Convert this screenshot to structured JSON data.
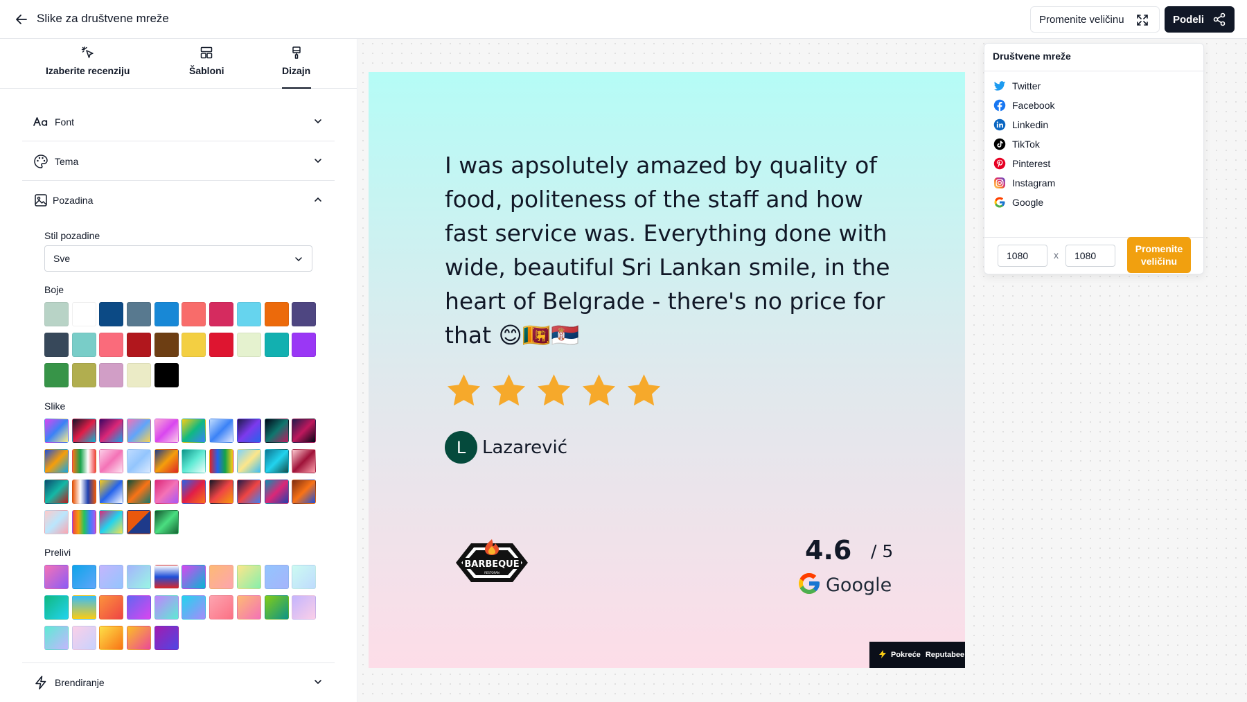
{
  "header": {
    "title": "Slike za društvene mreže",
    "resize_label": "Promenite veličinu",
    "share_label": "Podeli"
  },
  "tabs": [
    {
      "label": "Izaberite recenziju",
      "icon": "cursor-click-icon",
      "active": false
    },
    {
      "label": "Šabloni",
      "icon": "layout-template-icon",
      "active": false
    },
    {
      "label": "Dizajn",
      "icon": "paintbrush-icon",
      "active": true
    }
  ],
  "sections": {
    "font": "Font",
    "tema": "Tema",
    "pozadina": "Pozadina",
    "brendiranje": "Brendiranje"
  },
  "background": {
    "style_label": "Stil pozadine",
    "style_value": "Sve",
    "colors_label": "Boje",
    "images_label": "Slike",
    "gradients_label": "Prelivi",
    "colors": [
      "#b8d3c6",
      "#ffffff",
      "#0c4a85",
      "#58798f",
      "#1888d6",
      "#f86c6a",
      "#d52b5f",
      "#66d4ee",
      "#ec6a0b",
      "#4e4681",
      "#37485a",
      "#79cdc8",
      "#fa6b7b",
      "#b1171d",
      "#6d3e13",
      "#f3cf42",
      "#de1530",
      "#e5f2cf",
      "#12b0b0",
      "#9a37f5",
      "#379448",
      "#b1ae4f",
      "#d19ec6",
      "#ebebc6",
      "#000000"
    ],
    "images": [
      "linear-gradient(135deg,#d946ef,#3b82f6,#fef08a)",
      "linear-gradient(135deg,#0f172a,#e11d48,#06b6d4)",
      "linear-gradient(135deg,#3b0764,#db2777,#0ea5e9)",
      "linear-gradient(135deg,#f472b6,#60a5fa,#fcd34d)",
      "linear-gradient(135deg,#f9a8d4,#d946ef,#fbcfe8)",
      "linear-gradient(135deg,#facc15,#10b981,#3b82f6)",
      "linear-gradient(135deg,#bfdbfe,#3b82f6,#e0e7ff)",
      "linear-gradient(135deg,#1e1b4b,#7c3aed,#2563eb)",
      "linear-gradient(135deg,#020617,#0f766e,#be185d)",
      "linear-gradient(135deg,#1e1b4b,#be185d,#020617)",
      "linear-gradient(135deg,#1d4ed8,#f59e0b,#0ea5e9)",
      "linear-gradient(90deg,#f97316,#16a34a,#ffffff,#ef4444)",
      "linear-gradient(135deg,#fbcfe8,#f472b6,#fce7f3)",
      "linear-gradient(135deg,#bfdbfe,#93c5fd,#dbeafe)",
      "linear-gradient(135deg,#1e3a8a,#f59e0b,#dc2626)",
      "linear-gradient(135deg,#0d9488,#5eead4,#f0fdfa)",
      "linear-gradient(90deg,#dc2626,#2563eb,#16a34a,#facc15)",
      "linear-gradient(135deg,#7dd3fc,#fde68a,#38bdf8)",
      "linear-gradient(135deg,#0e7490,#22d3ee,#134e4a)",
      "linear-gradient(135deg,#fecdd3,#9f1239,#fda4af)",
      "linear-gradient(135deg,#0c4a6e,#14b8a6,#b91c1c)",
      "linear-gradient(90deg,#ea580c,#ffffff,#1e40af,#ea580c)",
      "linear-gradient(135deg,#facc15,#2563eb,#ffffff)",
      "linear-gradient(135deg,#064e3b,#f97316,#0f766e)",
      "linear-gradient(135deg,#db2777,#f472b6,#a855f7)",
      "linear-gradient(135deg,#2563eb,#e11d48,#f97316)",
      "linear-gradient(135deg,#111827,#ef4444,#f59e0b)",
      "linear-gradient(135deg,#1e1b4b,#ef4444,#3b82f6)",
      "linear-gradient(135deg,#0891b2,#db2777,#1e40af)",
      "linear-gradient(135deg,#7c2d12,#f97316,#1d4ed8)",
      "linear-gradient(135deg,#fecaca,#bae6fd,#fda4af)",
      "linear-gradient(90deg,#ef4444,#f59e0b,#22c55e,#3b82f6,#a855f7)",
      "linear-gradient(135deg,#db2777,#22d3ee,#fde047)",
      "linear-gradient(135deg,#ea580c 50%,#1e3a8a 50%)",
      "linear-gradient(135deg,#14532d,#4ade80,#166534)"
    ],
    "gradients": [
      "linear-gradient(135deg,#f472b6,#8b5cf6)",
      "linear-gradient(135deg,#0ea5e9,#60a5fa)",
      "linear-gradient(135deg,#c4b5fd,#93c5fd)",
      "linear-gradient(135deg,#a5b4fc,#99f6e4)",
      "linear-gradient(180deg,#ffffff,#1d4ed8,#dc2626)",
      "linear-gradient(135deg,#d946ef,#06b6d4)",
      "linear-gradient(135deg,#fdba74,#fda4af)",
      "linear-gradient(135deg,#fde68a,#86efac)",
      "linear-gradient(135deg,#93c5fd,#a5b4fc)",
      "linear-gradient(135deg,#ccfbf1,#bfdbfe)",
      "linear-gradient(135deg,#10b981,#22d3ee)",
      "linear-gradient(180deg,#38bdf8,#facc15)",
      "linear-gradient(135deg,#fb923c,#ef4444)",
      "linear-gradient(135deg,#6366f1,#d946ef)",
      "linear-gradient(135deg,#c084fc,#5eead4)",
      "linear-gradient(135deg,#22d3ee,#a78bfa)",
      "linear-gradient(135deg,#fda4af,#fb7185)",
      "linear-gradient(135deg,#fdba74,#f472b6)",
      "linear-gradient(135deg,#84cc16,#0d9488)",
      "linear-gradient(135deg,#c4b5fd,#fbcfe8)",
      "linear-gradient(135deg,#5eead4,#c4b5fd)",
      "linear-gradient(135deg,#fbcfe8,#c7d2fe)",
      "linear-gradient(135deg,#fde047,#f97316)",
      "linear-gradient(135deg,#fbbf24,#ec4899)",
      "linear-gradient(135deg,#a21caf,#4f46e5)"
    ]
  },
  "review": {
    "text": "I was apsolutely amazed by quality of food, politeness of the staff and how fast service was. Everything done with wide, beautiful Sri Lankan smile, in the heart of Belgrade - there's no price for that 😊🇱🇰🇷🇸",
    "stars": 5,
    "avatar_letter": "L",
    "author": "Lazarević",
    "logo_text": "BARBEQUE",
    "logo_subtext": "RESTORAN",
    "rating_value": "4.6",
    "rating_scale": "/ 5",
    "platform": "Google",
    "powered_by": "Pokreće",
    "powered_brand": "Reputabee"
  },
  "dropdown": {
    "title": "Društvene mreže",
    "items": [
      {
        "label": "Twitter",
        "icon": "twitter-icon",
        "color": "#1d9bf0"
      },
      {
        "label": "Facebook",
        "icon": "facebook-icon",
        "color": "#1877f2"
      },
      {
        "label": "Linkedin",
        "icon": "linkedin-icon",
        "color": "#0a66c2"
      },
      {
        "label": "TikTok",
        "icon": "tiktok-icon",
        "color": "#000000"
      },
      {
        "label": "Pinterest",
        "icon": "pinterest-icon",
        "color": "#e60023"
      },
      {
        "label": "Instagram",
        "icon": "instagram-icon",
        "color": "#d62976"
      },
      {
        "label": "Google",
        "icon": "google-icon",
        "color": "#4285f4"
      }
    ],
    "width": "1080",
    "height": "1080",
    "x_sep": "x",
    "apply_label": "Promenite veličinu"
  },
  "colors": {
    "accent": "#f1a00f",
    "dark": "#111827",
    "star": "#f6a92b"
  }
}
